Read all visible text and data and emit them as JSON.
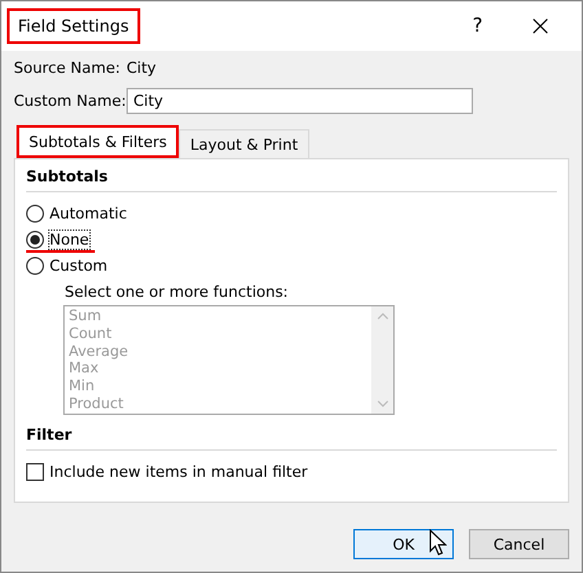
{
  "window": {
    "title": "Field Settings",
    "title_highlighted": true,
    "help": "?"
  },
  "source_name": {
    "label": "Source Name:",
    "value": "City"
  },
  "custom_name": {
    "label": "Custom Name:",
    "value": "City"
  },
  "tabs": [
    {
      "label": "Subtotals & Filters",
      "selected": true,
      "highlighted": true
    },
    {
      "label": "Layout & Print",
      "selected": false,
      "highlighted": false
    }
  ],
  "subtotals": {
    "heading": "Subtotals",
    "options": [
      {
        "label": "Automatic",
        "selected": false,
        "highlighted": false
      },
      {
        "label": "None",
        "selected": true,
        "highlighted": true
      },
      {
        "label": "Custom",
        "selected": false,
        "highlighted": false
      }
    ],
    "functions_label": "Select one or more functions:",
    "functions": [
      "Sum",
      "Count",
      "Average",
      "Max",
      "Min",
      "Product"
    ],
    "functions_disabled": true
  },
  "filter": {
    "heading": "Filter",
    "include_new": {
      "label": "Include new items in manual filter",
      "checked": false
    }
  },
  "buttons": [
    {
      "label": "OK",
      "default": true
    },
    {
      "label": "Cancel",
      "default": false
    }
  ]
}
